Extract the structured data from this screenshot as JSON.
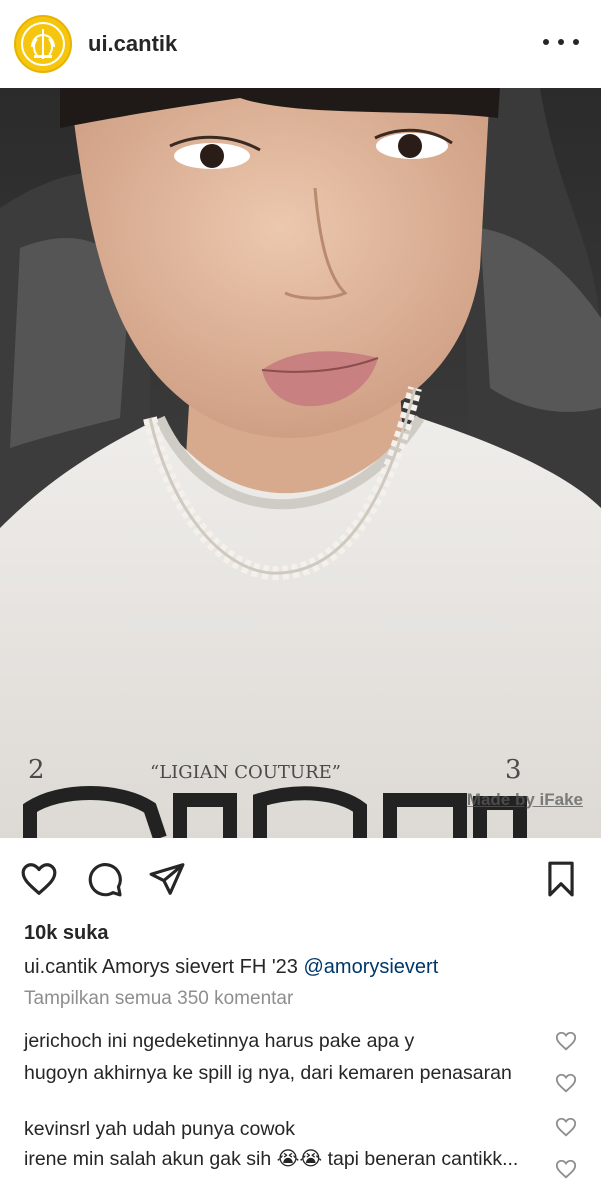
{
  "post": {
    "username": "ui.cantik",
    "watermark": "Made by iFake",
    "shirt_print": "“LIGIAN COUTURE”"
  },
  "actions": {
    "like_icon": "heart-outline-icon",
    "comment_icon": "comment-bubble-icon",
    "share_icon": "paper-plane-icon",
    "save_icon": "bookmark-icon"
  },
  "likes": "10k suka",
  "caption": {
    "user": "ui.cantik",
    "text": "Amorys sievert FH '23",
    "mention": "@amorysievert"
  },
  "view_all": "Tampilkan semua 350 komentar",
  "comments": [
    {
      "user": "jerichoch",
      "text": "ini ngedeketinnya harus pake apa y"
    },
    {
      "user": "hugoyn",
      "text": "akhirnya ke spill ig nya, dari kemaren penasaran"
    },
    {
      "user": "kevinsrl",
      "text": "yah udah punya cowok"
    },
    {
      "user": "irene",
      "text": "min salah akun gak sih 😭😭 tapi beneran cantikk..."
    }
  ],
  "colors": {
    "text": "#262626",
    "secondary": "#8e8e8e",
    "mention": "#00376b",
    "avatar": "#f6c60f"
  }
}
